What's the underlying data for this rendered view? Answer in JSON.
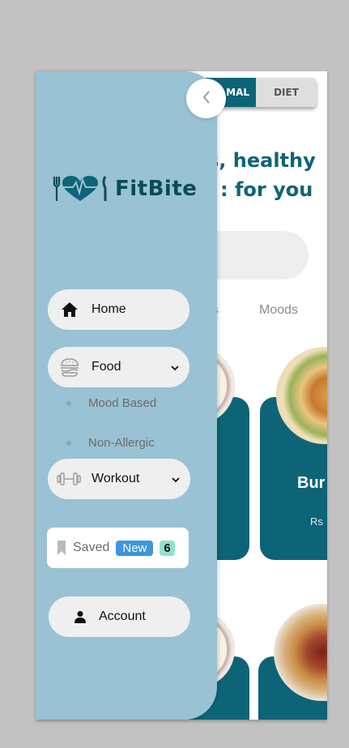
{
  "diet_toggle": {
    "normal_label": "MAL",
    "diet_label": "DIET"
  },
  "headline": {
    "line1": "s, healthy",
    "line2": ": for you"
  },
  "categories": [
    "ries",
    "Moods"
  ],
  "cards": [
    {
      "title": "Bur",
      "price": "Rs"
    }
  ],
  "brand": {
    "name": "FitBite"
  },
  "nav": {
    "home": "Home",
    "food": "Food",
    "food_sub": [
      "Mood Based",
      "Non-Allergic"
    ],
    "workout": "Workout",
    "saved": "Saved",
    "saved_badge": "New",
    "saved_count": "6",
    "account": "Account"
  },
  "colors": {
    "brand_dark": "#0d6477",
    "drawer_bg": "#99c2d4",
    "pill_bg": "#efefef",
    "badge_blue": "#3e96dd",
    "badge_green": "#8fe3cd"
  },
  "icons": {
    "back": "chevron-left-icon",
    "home": "home-icon",
    "food": "burger-icon",
    "workout": "dumbbell-icon",
    "saved": "bookmark-icon",
    "account": "person-icon"
  }
}
